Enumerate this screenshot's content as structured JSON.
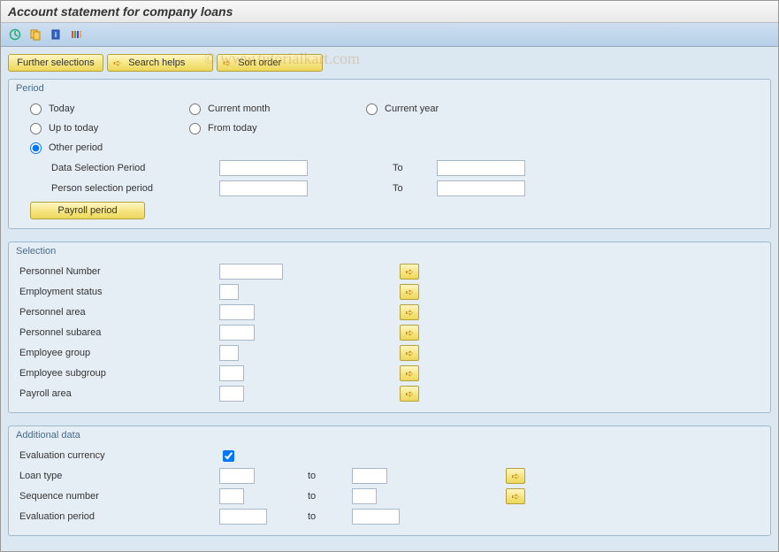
{
  "title": "Account statement for company loans",
  "watermark": "© www.tutorialkart.com",
  "buttons": {
    "further": "Further selections",
    "search": "Search helps",
    "sort": "Sort order",
    "payroll": "Payroll period"
  },
  "period": {
    "title": "Period",
    "today": "Today",
    "up_to_today": "Up to today",
    "other": "Other period",
    "current_month": "Current month",
    "from_today": "From today",
    "current_year": "Current year",
    "data_sel": "Data Selection Period",
    "person_sel": "Person selection period",
    "to": "To"
  },
  "selection": {
    "title": "Selection",
    "pernr": "Personnel Number",
    "emp_status": "Employment status",
    "pers_area": "Personnel area",
    "pers_subarea": "Personnel subarea",
    "emp_group": "Employee group",
    "emp_subgroup": "Employee subgroup",
    "payroll_area": "Payroll area"
  },
  "additional": {
    "title": "Additional data",
    "eval_currency": "Evaluation currency",
    "loan_type": "Loan type",
    "seq_number": "Sequence number",
    "eval_period": "Evaluation period",
    "to": "to"
  }
}
